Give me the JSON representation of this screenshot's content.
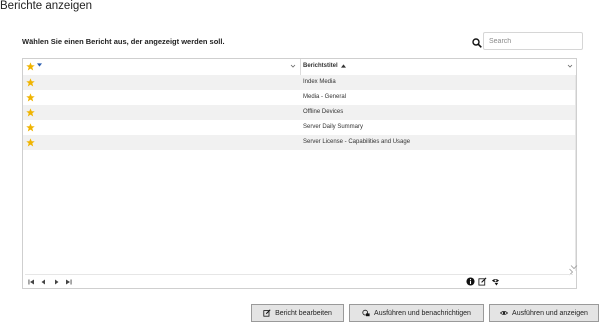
{
  "page": {
    "title": "Berichte anzeigen",
    "instruction": "Wählen Sie einen Bericht aus, der angezeigt werden soll."
  },
  "search": {
    "placeholder": "Search",
    "value": ""
  },
  "grid": {
    "columns": {
      "favorite": "",
      "title": "Berichtstitel"
    },
    "rows": [
      {
        "favorite": true,
        "title": "Index Media"
      },
      {
        "favorite": true,
        "title": "Media - General"
      },
      {
        "favorite": true,
        "title": "Offline Devices"
      },
      {
        "favorite": true,
        "title": "Server Daily Summary"
      },
      {
        "favorite": true,
        "title": "Server License - Capabilities and Usage"
      }
    ]
  },
  "actions": {
    "edit_label": "Bericht bearbeiten",
    "run_notify_label": "Ausführen und benachrichtigen",
    "run_view_label": "Ausführen und anzeigen"
  },
  "colors": {
    "star": "#f0b400",
    "button_bg": "#e4e4e4",
    "row_alt": "#f1f1f1"
  }
}
